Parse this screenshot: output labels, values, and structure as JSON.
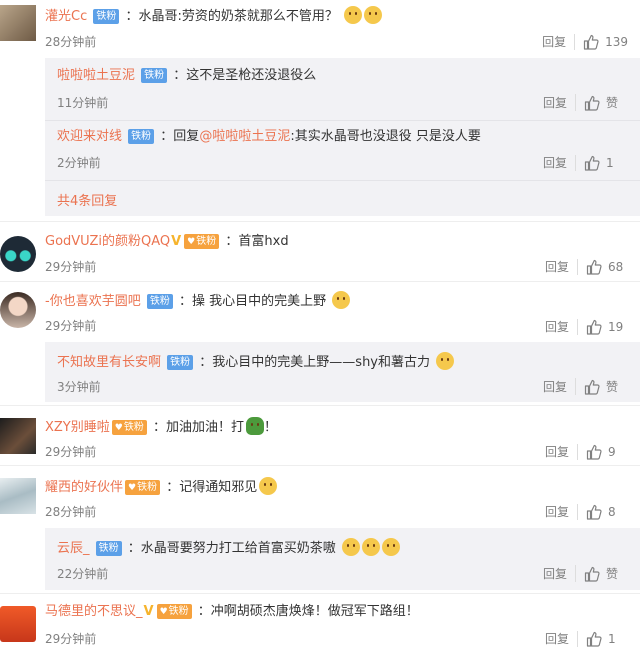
{
  "ui": {
    "reply": "回复"
  },
  "comments": [
    {
      "user": "灌光Cc",
      "badge": "铁粉",
      "badge_style": "blue",
      "text": "：水晶哥:劳资的奶茶就那么不管用？",
      "emojis": [
        "doge",
        "doge"
      ],
      "time": "28分钟前",
      "likes": "139",
      "replies": [
        {
          "user": "啦啦啦土豆泥",
          "badge": "铁粉",
          "text": "：这不是圣枪还没退役么",
          "time": "11分钟前",
          "likes": "赞"
        },
        {
          "user": "欢迎来对线",
          "badge": "铁粉",
          "prefix": "：回复",
          "at": "@啦啦啦土豆泥",
          "text": ":其实水晶哥也没退役    只是没人要",
          "time": "2分钟前",
          "likes": "1"
        }
      ],
      "more": "共4条回复"
    },
    {
      "user": "GodVUZi的颜粉QAQ",
      "badge": "铁粉",
      "badge_style": "orange",
      "verified": "V",
      "text": "：首富hxd",
      "time": "29分钟前",
      "likes": "68"
    },
    {
      "user": "-你也喜欢芋圆吧",
      "badge": "铁粉",
      "badge_style": "blue",
      "text": "：操 我心目中的完美上野",
      "emojis": [
        "shy"
      ],
      "time": "29分钟前",
      "likes": "19",
      "replies": [
        {
          "user": "不知故里有长安啊",
          "badge": "铁粉",
          "text": "：我心目中的完美上野——shy和薯古力",
          "emojis": [
            "laugh"
          ],
          "time": "3分钟前",
          "likes": "赞"
        }
      ]
    },
    {
      "user": "XZY别睡啦",
      "badge": "铁粉",
      "badge_style": "orange",
      "text": "：加油加油！打",
      "emojis": [
        "turtle"
      ],
      "text_after": "！",
      "time": "29分钟前",
      "likes": "9"
    },
    {
      "user": "耀西的好伙伴",
      "badge": "铁粉",
      "badge_style": "orange",
      "text": "：记得通知邪见",
      "emojis": [
        "doge"
      ],
      "time": "28分钟前",
      "likes": "8",
      "replies": [
        {
          "user": "云辰_",
          "badge": "铁粉",
          "text": "：水晶哥要努力打工给首富买奶茶嗷",
          "emojis": [
            "doge",
            "doge",
            "doge"
          ],
          "time": "22分钟前",
          "likes": "赞"
        }
      ]
    },
    {
      "user": "马德里的不思议_",
      "badge": "铁粉",
      "badge_style": "orange",
      "verified": "V",
      "text": "：冲啊胡硕杰唐焕烽！做冠军下路组！",
      "time": "29分钟前",
      "likes": "1"
    }
  ]
}
